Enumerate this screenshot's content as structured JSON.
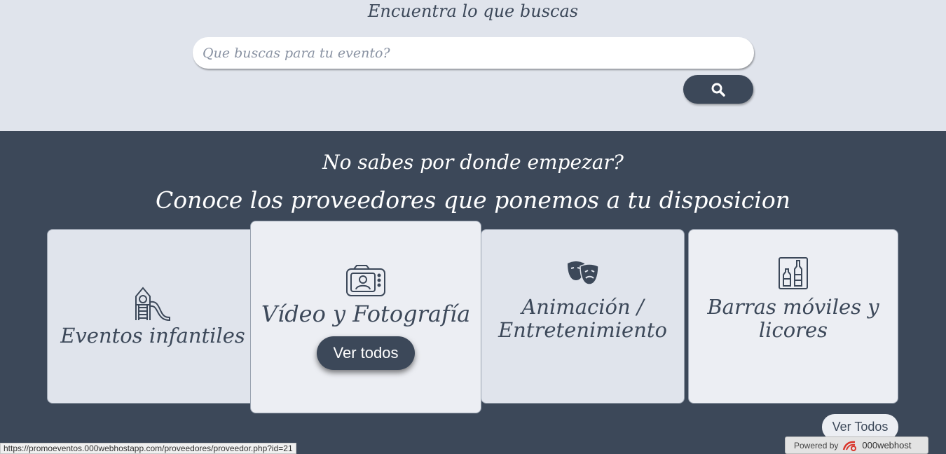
{
  "search": {
    "title": "Encuentra lo que buscas",
    "placeholder": "Que buscas para tu evento?",
    "button_icon": "search-icon"
  },
  "providers": {
    "question": "No sabes por donde empezar?",
    "heading": "Conoce los proveedores que ponemos a tu disposicion",
    "cards": [
      {
        "label": "Eventos infantiles",
        "icon": "playground-slide-icon"
      },
      {
        "label": "Vídeo y Fotografía",
        "icon": "photo-camera-icon",
        "button": "Ver todos"
      },
      {
        "label": "Animación / Entretenimiento",
        "icon": "theater-masks-icon"
      },
      {
        "label": "Barras móviles y licores",
        "icon": "bottles-cabinet-icon"
      }
    ],
    "view_all": "Ver Todos"
  },
  "status_bar": {
    "url": "https://promoeventos.000webhostapp.com/proveedores/proveedor.php?id=21"
  },
  "badge": {
    "powered": "Powered by",
    "brand": "000webhost"
  },
  "colors": {
    "dark": "#3c4859",
    "light": "#e0e4ec",
    "card_light": "#eceef3"
  }
}
